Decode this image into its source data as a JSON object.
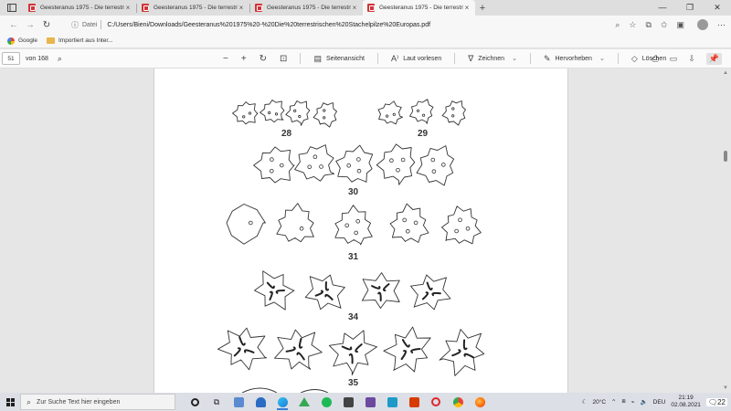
{
  "browser": {
    "tabs": [
      {
        "title": "Geesteranus 1975 - Die terrestri",
        "active": false
      },
      {
        "title": "Geesteranus 1975 - Die terrestri",
        "active": false
      },
      {
        "title": "Geesteranus 1975 - Die terrestri",
        "active": false
      },
      {
        "title": "Geesteranus 1975 - Die terrestri",
        "active": true
      }
    ],
    "url_scheme": "Datei",
    "url": "C:/Users/Bieni/Downloads/Geesteranus%201975%20-%20Die%20terrestrischen%20Stachelpilze%20Europas.pdf",
    "bookmarks": [
      {
        "label": "Google",
        "icon": "google-icon"
      },
      {
        "label": "Importiert aus Inter...",
        "icon": "folder-icon"
      }
    ]
  },
  "pdf_toolbar": {
    "page_number": "51",
    "page_total": "von 168",
    "page_view": "Seitenansicht",
    "read_aloud": "Laut vorlesen",
    "draw": "Zeichnen",
    "highlight": "Hervorheben",
    "erase": "Löschen"
  },
  "figure_labels": {
    "fig28": "28",
    "fig29": "29",
    "fig30": "30",
    "fig31": "31",
    "fig34": "34",
    "fig35": "35"
  },
  "taskbar": {
    "search_placeholder": "Zur Suche Text hier eingeben",
    "weather": "20°C",
    "language": "DEU",
    "time": "21:19",
    "date": "02.08.2021",
    "notifications": "22"
  }
}
